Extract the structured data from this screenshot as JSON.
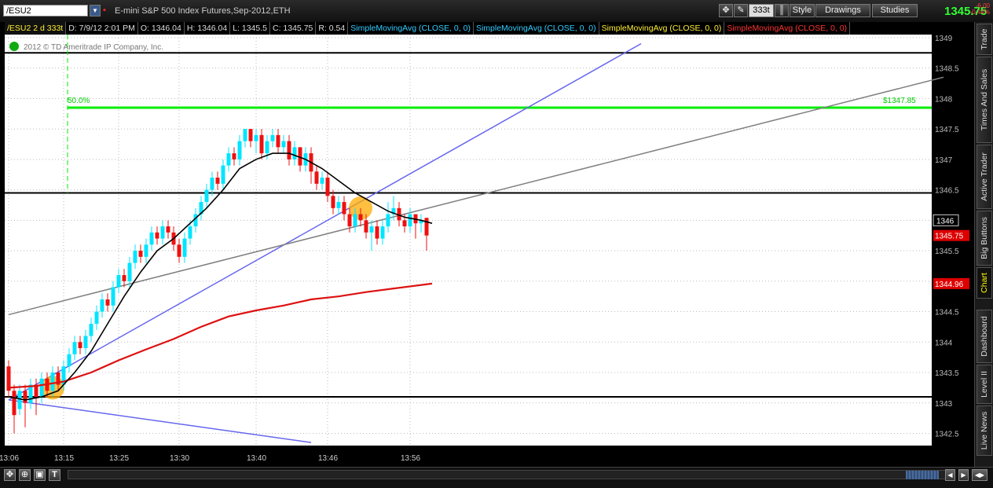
{
  "header": {
    "symbol": "/ESU2",
    "description": "E-mini S&P 500 Index Futures,Sep-2012,ETH",
    "aggregation": "333t",
    "style_label": "Style",
    "drawings_label": "Drawings",
    "studies_label": "Studies",
    "last_price": "1345.75",
    "change_abs": "-6.00",
    "change_pct": "-0.44%"
  },
  "infobar": {
    "symbol_period": "/ESU2 2 d 333t",
    "date": "D: 7/9/12 2:01 PM",
    "open": "O: 1346.04",
    "high": "H: 1346.04",
    "low": "L: 1345.5",
    "close": "C: 1345.75",
    "range": "R: 0.54",
    "studies": [
      {
        "label": "SimpleMovingAvg (CLOSE, 0, 0)",
        "color": "#33ccff"
      },
      {
        "label": "SimpleMovingAvg (CLOSE, 0, 0)",
        "color": "#33ccff"
      },
      {
        "label": "SimpleMovingAvg (CLOSE, 0, 0)",
        "color": "#ffee33"
      },
      {
        "label": "SimpleMovingAvg (CLOSE, 0, 0)",
        "color": "#ff3333"
      }
    ]
  },
  "copyright": "2012 © TD Ameritrade IP Company, Inc.",
  "right_tabs": [
    "Trade",
    "Times And Sales",
    "Active Trader",
    "Big Buttons",
    "Chart",
    "Dashboard",
    "Level II",
    "Live News"
  ],
  "active_tab": "Chart",
  "colors": {
    "up": "#00e5ff",
    "down": "#ee1111",
    "background": "#ffffff",
    "fib": "#00ee00",
    "sma_fast": "#000000",
    "sma_slow": "#dd1111",
    "trend1": "#6666ee",
    "trend2": "#808080",
    "highlight": "#ffaa00"
  },
  "chart_data": {
    "type": "candlestick",
    "ylim": [
      1342.3,
      1349.05
    ],
    "y_ticks": [
      "1349",
      "1348.5",
      "1348",
      "1347.5",
      "1347",
      "1346.5",
      "1346",
      "1345.5",
      "1345",
      "1344.5",
      "1344",
      "1343.5",
      "1343",
      "1342.5"
    ],
    "x_ticks": [
      "13:06",
      "13:15",
      "13:25",
      "13:30",
      "13:40",
      "13:46",
      "13:56"
    ],
    "fib_label": "50.0%",
    "fib_level": 1347.85,
    "fib_price_label": "$1347.85",
    "horizontal_levels": [
      1348.75,
      1346.45,
      1343.1
    ],
    "price_labels": [
      {
        "text": "1346",
        "value": 1346.0,
        "style": "boxed"
      },
      {
        "text": "1345.75",
        "value": 1345.75,
        "style": "red"
      },
      {
        "text": "1344.96",
        "value": 1344.96,
        "style": "red"
      }
    ],
    "candles": [
      [
        1343.6,
        1343.2,
        1343.7,
        1343.1
      ],
      [
        1343.2,
        1342.8,
        1343.3,
        1342.5
      ],
      [
        1342.9,
        1343.2,
        1343.3,
        1342.8
      ],
      [
        1343.2,
        1343.0,
        1343.3,
        1342.6
      ],
      [
        1343.0,
        1343.3,
        1343.4,
        1342.9
      ],
      [
        1343.3,
        1343.1,
        1343.4,
        1342.8
      ],
      [
        1343.1,
        1343.4,
        1343.5,
        1343.0
      ],
      [
        1343.4,
        1343.2,
        1343.5,
        1343.1
      ],
      [
        1343.2,
        1343.5,
        1343.6,
        1343.1
      ],
      [
        1343.5,
        1343.3,
        1343.6,
        1343.2
      ],
      [
        1343.3,
        1343.6,
        1343.7,
        1343.2
      ],
      [
        1343.6,
        1343.8,
        1343.9,
        1343.5
      ],
      [
        1343.8,
        1344.0,
        1344.1,
        1343.7
      ],
      [
        1344.0,
        1343.9,
        1344.1,
        1343.8
      ],
      [
        1343.9,
        1344.1,
        1344.2,
        1343.8
      ],
      [
        1344.1,
        1344.3,
        1344.4,
        1344.0
      ],
      [
        1344.3,
        1344.5,
        1344.6,
        1344.2
      ],
      [
        1344.5,
        1344.7,
        1344.8,
        1344.4
      ],
      [
        1344.7,
        1344.6,
        1344.8,
        1344.5
      ],
      [
        1344.6,
        1344.9,
        1345.0,
        1344.5
      ],
      [
        1344.9,
        1345.1,
        1345.2,
        1344.8
      ],
      [
        1345.1,
        1345.0,
        1345.2,
        1344.9
      ],
      [
        1345.0,
        1345.3,
        1345.4,
        1344.9
      ],
      [
        1345.3,
        1345.5,
        1345.6,
        1345.2
      ],
      [
        1345.5,
        1345.4,
        1345.6,
        1345.3
      ],
      [
        1345.4,
        1345.6,
        1345.7,
        1345.3
      ],
      [
        1345.6,
        1345.8,
        1345.9,
        1345.5
      ],
      [
        1345.8,
        1345.7,
        1345.9,
        1345.6
      ],
      [
        1345.7,
        1345.9,
        1346.0,
        1345.6
      ],
      [
        1345.9,
        1345.8,
        1346.0,
        1345.7
      ],
      [
        1345.8,
        1345.6,
        1345.9,
        1345.5
      ],
      [
        1345.6,
        1345.4,
        1345.7,
        1345.3
      ],
      [
        1345.4,
        1345.7,
        1345.8,
        1345.3
      ],
      [
        1345.7,
        1345.9,
        1346.0,
        1345.6
      ],
      [
        1345.9,
        1346.1,
        1346.2,
        1345.8
      ],
      [
        1346.1,
        1346.3,
        1346.4,
        1346.0
      ],
      [
        1346.3,
        1346.5,
        1346.6,
        1346.2
      ],
      [
        1346.5,
        1346.7,
        1346.8,
        1346.4
      ],
      [
        1346.7,
        1346.6,
        1346.8,
        1346.5
      ],
      [
        1346.6,
        1346.9,
        1347.0,
        1346.5
      ],
      [
        1346.9,
        1347.1,
        1347.2,
        1346.8
      ],
      [
        1347.1,
        1347.0,
        1347.2,
        1346.9
      ],
      [
        1347.0,
        1347.3,
        1347.4,
        1346.9
      ],
      [
        1347.3,
        1347.5,
        1347.5,
        1347.2
      ],
      [
        1347.5,
        1347.3,
        1347.5,
        1347.2
      ],
      [
        1347.3,
        1347.4,
        1347.5,
        1347.1
      ],
      [
        1347.4,
        1347.1,
        1347.5,
        1347.0
      ],
      [
        1347.1,
        1347.3,
        1347.4,
        1347.0
      ],
      [
        1347.3,
        1347.4,
        1347.5,
        1347.2
      ],
      [
        1347.4,
        1347.2,
        1347.5,
        1347.1
      ],
      [
        1347.2,
        1347.3,
        1347.4,
        1347.1
      ],
      [
        1347.3,
        1347.0,
        1347.4,
        1346.9
      ],
      [
        1347.0,
        1347.2,
        1347.3,
        1346.9
      ],
      [
        1347.2,
        1346.9,
        1347.2,
        1346.8
      ],
      [
        1346.9,
        1347.1,
        1347.2,
        1346.8
      ],
      [
        1347.1,
        1346.8,
        1347.2,
        1346.6
      ],
      [
        1346.8,
        1346.6,
        1346.9,
        1346.5
      ],
      [
        1346.6,
        1346.7,
        1346.8,
        1346.5
      ],
      [
        1346.7,
        1346.4,
        1346.8,
        1346.3
      ],
      [
        1346.4,
        1346.2,
        1346.5,
        1346.1
      ],
      [
        1346.2,
        1346.3,
        1346.4,
        1346.1
      ],
      [
        1346.3,
        1346.1,
        1346.4,
        1346.0
      ],
      [
        1346.1,
        1345.9,
        1346.2,
        1345.8
      ],
      [
        1345.9,
        1346.1,
        1346.2,
        1345.8
      ],
      [
        1346.1,
        1346.0,
        1346.2,
        1345.9
      ],
      [
        1346.0,
        1345.8,
        1346.1,
        1345.7
      ],
      [
        1345.8,
        1345.9,
        1346.0,
        1345.5
      ],
      [
        1345.9,
        1345.7,
        1346.0,
        1345.6
      ],
      [
        1345.7,
        1345.9,
        1346.0,
        1345.6
      ],
      [
        1345.9,
        1346.1,
        1346.3,
        1345.8
      ],
      [
        1346.1,
        1346.2,
        1346.4,
        1346.0
      ],
      [
        1346.2,
        1346.0,
        1346.3,
        1345.9
      ],
      [
        1346.0,
        1345.9,
        1346.1,
        1345.8
      ],
      [
        1345.9,
        1346.1,
        1346.2,
        1345.8
      ],
      [
        1346.1,
        1345.95,
        1346.1,
        1345.7
      ],
      [
        1345.95,
        1346.0,
        1346.1,
        1345.8
      ],
      [
        1346.04,
        1345.75,
        1346.04,
        1345.5
      ]
    ],
    "sma_fast": [
      [
        0,
        1343.1
      ],
      [
        3,
        1343.05
      ],
      [
        6,
        1343.1
      ],
      [
        9,
        1343.2
      ],
      [
        12,
        1343.5
      ],
      [
        15,
        1343.85
      ],
      [
        18,
        1344.3
      ],
      [
        21,
        1344.75
      ],
      [
        24,
        1345.15
      ],
      [
        27,
        1345.5
      ],
      [
        30,
        1345.7
      ],
      [
        33,
        1345.95
      ],
      [
        36,
        1346.2
      ],
      [
        39,
        1346.5
      ],
      [
        42,
        1346.85
      ],
      [
        45,
        1347.0
      ],
      [
        48,
        1347.1
      ],
      [
        51,
        1347.1
      ],
      [
        54,
        1347.0
      ],
      [
        57,
        1346.85
      ],
      [
        60,
        1346.65
      ],
      [
        63,
        1346.45
      ],
      [
        66,
        1346.3
      ],
      [
        69,
        1346.15
      ],
      [
        72,
        1346.05
      ],
      [
        75,
        1346.0
      ],
      [
        77,
        1345.95
      ]
    ],
    "sma_slow": [
      [
        0,
        1343.25
      ],
      [
        5,
        1343.28
      ],
      [
        10,
        1343.35
      ],
      [
        15,
        1343.5
      ],
      [
        20,
        1343.7
      ],
      [
        25,
        1343.88
      ],
      [
        30,
        1344.05
      ],
      [
        35,
        1344.25
      ],
      [
        40,
        1344.42
      ],
      [
        45,
        1344.52
      ],
      [
        50,
        1344.6
      ],
      [
        55,
        1344.7
      ],
      [
        60,
        1344.75
      ],
      [
        65,
        1344.82
      ],
      [
        70,
        1344.88
      ],
      [
        77,
        1344.96
      ]
    ],
    "trendlines": [
      {
        "id": "blue-up",
        "from": [
          0,
          1343.05
        ],
        "to": [
          115,
          1348.9
        ],
        "color": "#6666ee"
      },
      {
        "id": "gray",
        "from": [
          0,
          1344.45
        ],
        "to": [
          170,
          1348.35
        ],
        "color": "#808080"
      },
      {
        "id": "blue-down",
        "from": [
          0,
          1343.05
        ],
        "to": [
          55,
          1342.35
        ],
        "color": "#6666ee"
      }
    ],
    "highlights": [
      [
        8,
        1343.25
      ],
      [
        64,
        1346.2
      ]
    ]
  }
}
